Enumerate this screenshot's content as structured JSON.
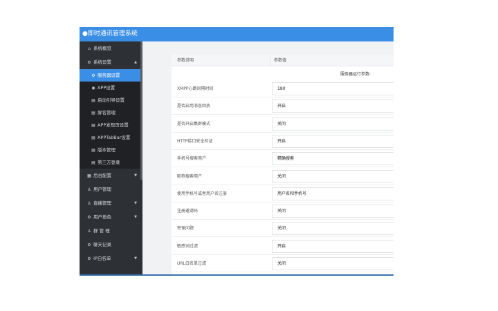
{
  "app": {
    "title": "●即时通讯管理系统"
  },
  "sidebar": {
    "items": [
      {
        "icon": "⌂",
        "icon_name": "home-icon",
        "label": "系统概览",
        "type": "top",
        "arrow": ""
      },
      {
        "icon": "⚙",
        "icon_name": "gear-icon",
        "label": "系统设置",
        "type": "top",
        "arrow": "▲"
      },
      {
        "icon": "⚙",
        "icon_name": "gear-icon",
        "label": "服务器设置",
        "type": "sub",
        "active": true
      },
      {
        "icon": "◉",
        "icon_name": "app-icon",
        "label": "APP设置",
        "type": "sub"
      },
      {
        "icon": "▤",
        "icon_name": "boot-page-icon",
        "label": "启动引导设置",
        "type": "sub"
      },
      {
        "icon": "▤",
        "icon_name": "sensitive-words-icon",
        "label": "屏名管理",
        "type": "sub"
      },
      {
        "icon": "▤",
        "icon_name": "discover-page-icon",
        "label": "APP发现页设置",
        "type": "sub"
      },
      {
        "icon": "▤",
        "icon_name": "tabbar-icon",
        "label": "APPTabBar设置",
        "type": "sub"
      },
      {
        "icon": "▤",
        "icon_name": "version-icon",
        "label": "版本管理",
        "type": "sub"
      },
      {
        "icon": "▤",
        "icon_name": "third-party-icon",
        "label": "第三方登录",
        "type": "sub"
      },
      {
        "icon": "▦",
        "icon_name": "calendar-icon",
        "label": "后台配置",
        "type": "top",
        "arrow": "▼"
      },
      {
        "icon": "♙",
        "icon_name": "user-icon",
        "label": "用户管理",
        "type": "top",
        "arrow": ""
      },
      {
        "icon": "♙",
        "icon_name": "live-icon",
        "label": "直播管理",
        "type": "top",
        "arrow": "▼"
      },
      {
        "icon": "⚙",
        "icon_name": "role-icon",
        "label": "用户角色",
        "type": "top",
        "arrow": "▼"
      },
      {
        "icon": "♙",
        "icon_name": "group-icon",
        "label": "群 管 理",
        "type": "top",
        "arrow": ""
      },
      {
        "icon": "⚙",
        "icon_name": "chat-record-icon",
        "label": "聊天记录",
        "type": "top",
        "arrow": ""
      },
      {
        "icon": "⚙",
        "icon_name": "ip-whitelist-icon",
        "label": "IP白名单",
        "type": "top",
        "arrow": "▼"
      }
    ]
  },
  "table": {
    "header": {
      "col1": "参数说明",
      "col2": "参数值"
    },
    "note": "服务器运行参数:",
    "rows": [
      {
        "label": "XMPP心跳间隔时间",
        "value": "180"
      },
      {
        "label": "是否启用消息回执",
        "value": "开启"
      },
      {
        "label": "是否开启集群模式",
        "value": "关闭"
      },
      {
        "label": "HTTP接口安全验证",
        "value": "开启"
      },
      {
        "label": "手机号搜索用户",
        "value": "精确搜索"
      },
      {
        "label": "昵称搜索用户",
        "value": "关闭"
      },
      {
        "label": "使用手机号或者用户名注册",
        "value": "用户名和手机号"
      },
      {
        "label": "注册邀请码",
        "value": "关闭"
      },
      {
        "label": "密保问题",
        "value": "关闭"
      },
      {
        "label": "敏感词过滤",
        "value": "开启"
      },
      {
        "label": "URL白名单过滤",
        "value": "关闭"
      }
    ]
  },
  "colors": {
    "accent": "#3a8ee6",
    "sidebar_bg": "#2d3035",
    "submenu_bg": "#1f2125"
  }
}
